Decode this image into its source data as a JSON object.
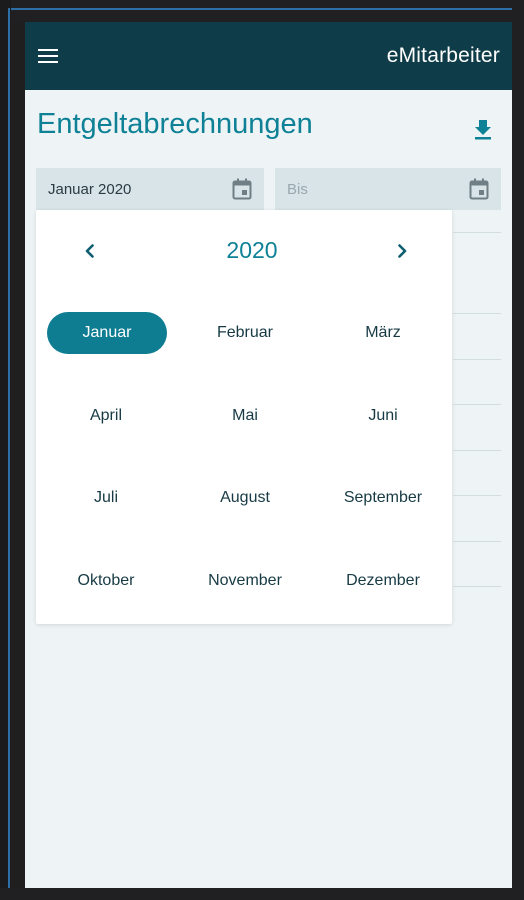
{
  "app": {
    "title": "eMitarbeiter",
    "colors": {
      "appbar": "#0e3d49",
      "accent": "#0e8197",
      "selected": "#0e7d92",
      "background": "#eef4f5"
    }
  },
  "page": {
    "title": "Entgeltabrechnungen",
    "download_icon": "download-icon"
  },
  "filters": {
    "from_value": "Januar 2020",
    "to_placeholder": "Bis",
    "calendar_icon": "calendar-icon"
  },
  "picker": {
    "year": "2020",
    "prev_icon": "chevron-left-icon",
    "next_icon": "chevron-right-icon",
    "selected_month": "Januar",
    "months": [
      "Januar",
      "Februar",
      "März",
      "April",
      "Mai",
      "Juni",
      "Juli",
      "August",
      "September",
      "Oktober",
      "November",
      "Dezember"
    ]
  }
}
